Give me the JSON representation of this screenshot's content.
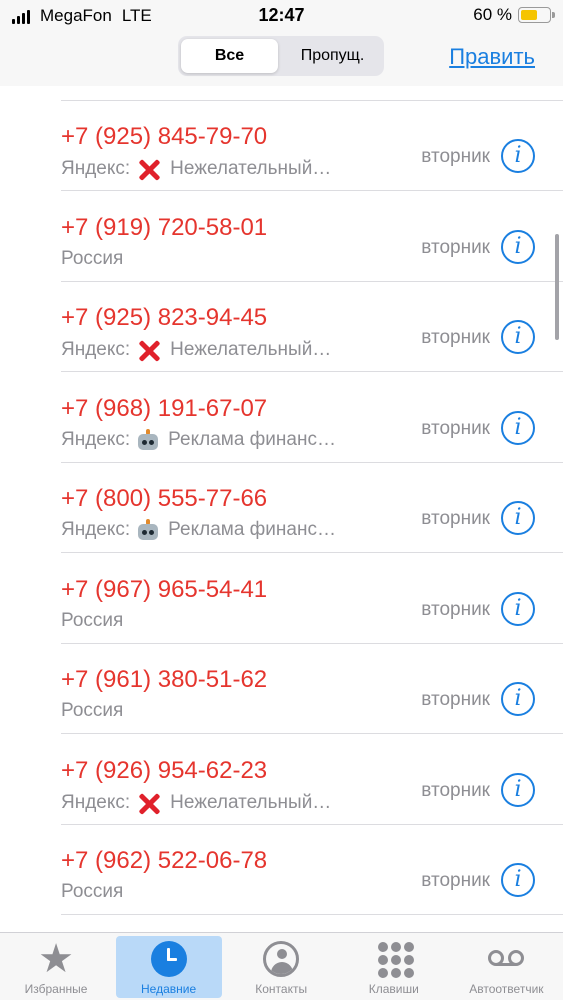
{
  "status_bar": {
    "carrier": "MegaFon",
    "network": "LTE",
    "time": "12:47",
    "battery_percent": "60 %",
    "battery_level": 0.6
  },
  "nav": {
    "segments": [
      "Все",
      "Пропущ."
    ],
    "selected_segment": "Все",
    "edit_label": "Править"
  },
  "calls": [
    {
      "number": "+7 (925) 845-79-70",
      "label": "Яндекс:",
      "icon": "red-x-icon",
      "desc": "Нежелательный…",
      "day": "вторник"
    },
    {
      "number": "+7 (919) 720-58-01",
      "label": "Россия",
      "icon": "",
      "desc": "",
      "day": "вторник"
    },
    {
      "number": "+7 (925) 823-94-45",
      "label": "Яндекс:",
      "icon": "red-x-icon",
      "desc": "Нежелательный…",
      "day": "вторник"
    },
    {
      "number": "+7 (968) 191-67-07",
      "label": "Яндекс:",
      "icon": "robot-icon",
      "desc": "Реклама финанс…",
      "day": "вторник"
    },
    {
      "number": "+7 (800) 555-77-66",
      "label": "Яндекс:",
      "icon": "robot-icon",
      "desc": "Реклама финанс…",
      "day": "вторник"
    },
    {
      "number": "+7 (967) 965-54-41",
      "label": "Россия",
      "icon": "",
      "desc": "",
      "day": "вторник"
    },
    {
      "number": "+7 (961) 380-51-62",
      "label": "Россия",
      "icon": "",
      "desc": "",
      "day": "вторник"
    },
    {
      "number": "+7 (926) 954-62-23",
      "label": "Яндекс:",
      "icon": "red-x-icon",
      "desc": "Нежелательный…",
      "day": "вторник"
    },
    {
      "number": "+7 (962) 522-06-78",
      "label": "Россия",
      "icon": "",
      "desc": "",
      "day": "вторник"
    }
  ],
  "tabs": [
    {
      "label": "Избранные",
      "icon": "star-icon",
      "active": false
    },
    {
      "label": "Недавние",
      "icon": "clock-icon",
      "active": true
    },
    {
      "label": "Контакты",
      "icon": "contacts-icon",
      "active": false
    },
    {
      "label": "Клавиши",
      "icon": "keypad-icon",
      "active": false
    },
    {
      "label": "Автоответчик",
      "icon": "voicemail-icon",
      "active": false
    }
  ],
  "colors": {
    "missed_call": "#e5352e",
    "accent": "#1a7fe0",
    "secondary_text": "#8e8e93"
  }
}
